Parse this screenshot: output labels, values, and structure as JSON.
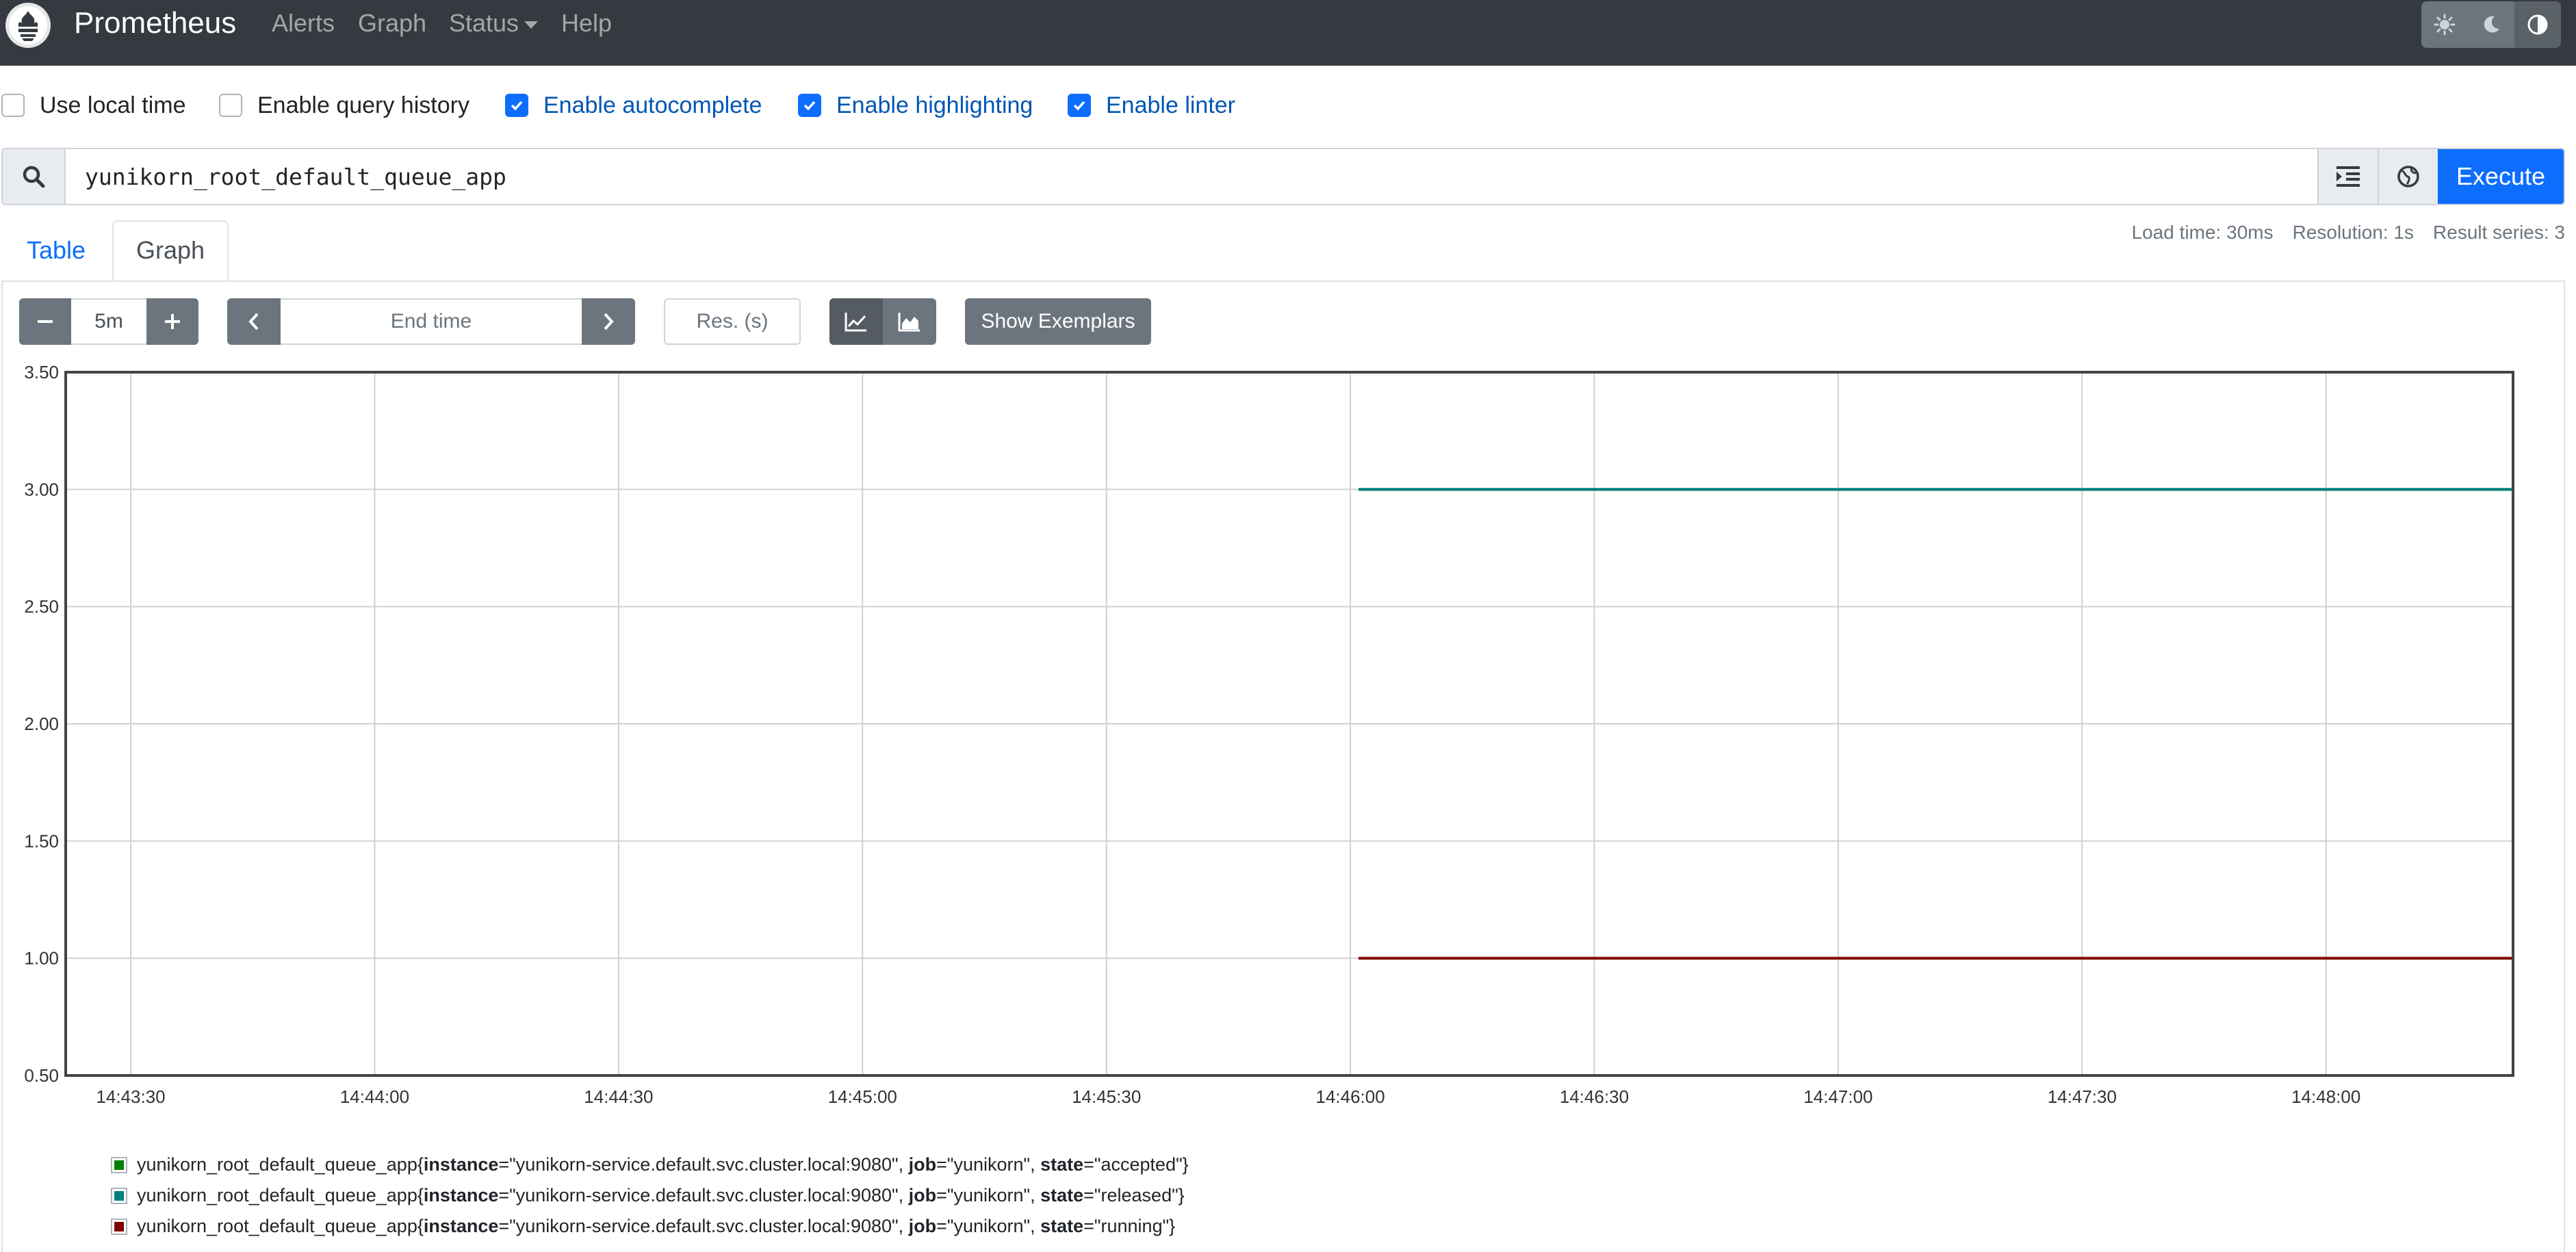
{
  "navbar": {
    "brand": "Prometheus",
    "links": [
      "Alerts",
      "Graph",
      "Status",
      "Help"
    ],
    "theme_icons": [
      "sun-icon",
      "moon-icon",
      "contrast-icon"
    ]
  },
  "options": [
    {
      "label": "Use local time",
      "checked": false
    },
    {
      "label": "Enable query history",
      "checked": false
    },
    {
      "label": "Enable autocomplete",
      "checked": true
    },
    {
      "label": "Enable highlighting",
      "checked": true
    },
    {
      "label": "Enable linter",
      "checked": true
    }
  ],
  "expression": {
    "value": "yunikorn_root_default_queue_app",
    "execute_label": "Execute"
  },
  "tabs": [
    "Table",
    "Graph"
  ],
  "active_tab": "Graph",
  "stats": {
    "load_time": "Load time: 30ms",
    "resolution": "Resolution: 1s",
    "result_series": "Result series: 3"
  },
  "graph_controls": {
    "range": "5m",
    "end_time_placeholder": "End time",
    "resolution_placeholder": "Res. (s)",
    "exemplars_label": "Show Exemplars"
  },
  "chart_data": {
    "type": "line",
    "x_ticks": [
      "14:43:30",
      "14:44:00",
      "14:44:30",
      "14:45:00",
      "14:45:30",
      "14:46:00",
      "14:46:30",
      "14:47:00",
      "14:47:30",
      "14:48:00"
    ],
    "y_ticks": [
      "0.50",
      "1.00",
      "1.50",
      "2.00",
      "2.50",
      "3.00",
      "3.50"
    ],
    "ylim": [
      0.5,
      3.5
    ],
    "xlim": [
      "14:43:22",
      "14:48:23"
    ],
    "series": [
      {
        "x_start": "14:46:01",
        "x_end": "14:48:23",
        "value": 3,
        "color": "#008000"
      },
      {
        "x_start": "14:46:01",
        "x_end": "14:48:23",
        "value": 3,
        "color": "#008080"
      },
      {
        "x_start": "14:46:01",
        "x_end": "14:48:23",
        "value": 1,
        "color": "#800000"
      }
    ]
  },
  "legend": [
    {
      "metric": "yunikorn_root_default_queue_app",
      "instance": "yunikorn-service.default.svc.cluster.local:9080",
      "job": "yunikorn",
      "state": "accepted",
      "color": "#008000"
    },
    {
      "metric": "yunikorn_root_default_queue_app",
      "instance": "yunikorn-service.default.svc.cluster.local:9080",
      "job": "yunikorn",
      "state": "released",
      "color": "#008080"
    },
    {
      "metric": "yunikorn_root_default_queue_app",
      "instance": "yunikorn-service.default.svc.cluster.local:9080",
      "job": "yunikorn",
      "state": "running",
      "color": "#800000"
    }
  ],
  "legend_labels": {
    "instance": "instance",
    "job": "job",
    "state": "state"
  }
}
